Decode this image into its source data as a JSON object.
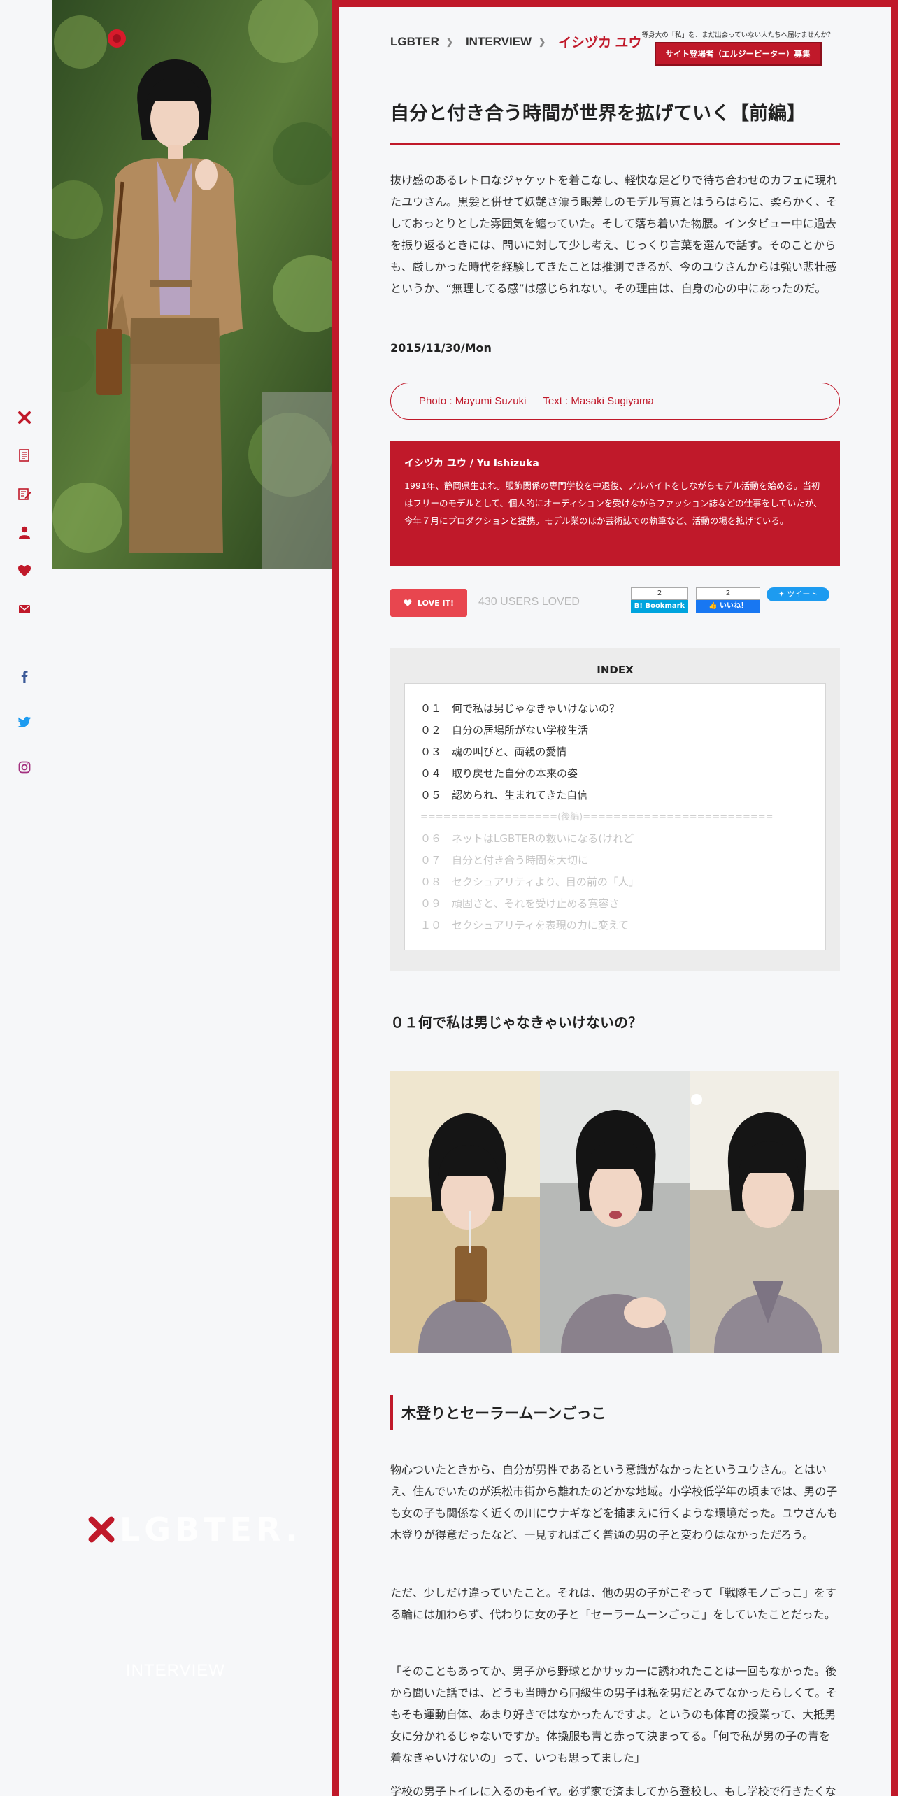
{
  "rail": {
    "icons": [
      "lgbter-x-icon",
      "article-icon",
      "edit-icon",
      "person-icon",
      "heart-icon",
      "mail-icon",
      "facebook-icon",
      "twitter-icon",
      "instagram-icon"
    ]
  },
  "hero": {
    "logo_text": "LGBTER.",
    "category": "INTERVIEW"
  },
  "breadcrumb": {
    "home": "LGBTER",
    "category": "INTERVIEW",
    "current": "イシヅカ ユウ"
  },
  "recruit": {
    "note": "等身大の「私」を、まだ出会っていない人たちへ届けませんか？",
    "button": "サイト登場者（エルジービーター）募集"
  },
  "article": {
    "title": "自分と付き合う時間が世界を拡げていく【前編】",
    "lead": "抜け感のあるレトロなジャケットを着こなし、軽快な足どりで待ち合わせのカフェに現れたユウさん。黒髪と併せて妖艶さ漂う眼差しのモデル写真とはうらはらに、柔らかく、そしておっとりとした雰囲気を纏っていた。そして落ち着いた物腰。インタビュー中に過去を振り返るときには、問いに対して少し考え、じっくり言葉を選んで話す。そのことからも、厳しかった時代を経験してきたことは推測できるが、今のユウさんからは強い悲壮感というか、“無理してる感”は感じられない。その理由は、自身の心の中にあったのだ。",
    "date": "2015/11/30/Mon",
    "photo_credit": "Photo : Mayumi Suzuki",
    "text_credit": "Text : Masaki Sugiyama"
  },
  "profile": {
    "name": "イシヅカ ユウ / Yu Ishizuka",
    "text": "1991年、静岡県生まれ。服飾関係の専門学校を中退後、アルバイトをしながらモデル活動を始める。当初はフリーのモデルとして、個人的にオーディションを受けながらファッション誌などの仕事をしていたが、今年７月にプロダクションと提携。モデル業のほか芸術誌での執筆など、活動の場を拡げている。"
  },
  "actions": {
    "love_label": "LOVE IT!",
    "loved_count": "430 USERS LOVED",
    "hatena_count": "2",
    "hatena_label": "B! Bookmark",
    "fb_count": "2",
    "fb_label": "いいね！",
    "tweet_label": "ツイート",
    "colors": {
      "love": "#e8464f",
      "hatena": "#00a4de",
      "facebook": "#1877f2",
      "twitter": "#1d9bf0"
    }
  },
  "index": {
    "title": "INDEX",
    "items": [
      "０１　何で私は男じゃなきゃいけないの？",
      "０２　自分の居場所がない学校生活",
      "０３　魂の叫びと、両親の愛情",
      "０４　取り戻せた自分の本来の姿",
      "０５　認められ、生まれてきた自信"
    ],
    "separator": "==================(後編)=========================",
    "later_items": [
      "０６　ネットはLGBTERの救いになる(けれど",
      "０７　自分と付き合う時間を大切に",
      "０８　セクシュアリティより、目の前の「人」",
      "０９　頑固さと、それを受け止める寛容さ",
      "１０　セクシュアリティを表現の力に変えて"
    ]
  },
  "section1": {
    "heading": "０１何で私は男じゃなきゃいけないの？",
    "subheading": "木登りとセーラームーンごっこ",
    "paragraphs": [
      "物心ついたときから、自分が男性であるという意識がなかったというユウさん。とはいえ、住んでいたのが浜松市街から離れたのどかな地域。小学校低学年の頃までは、男の子も女の子も関係なく近くの川にウナギなどを捕まえに行くような環境だった。ユウさんも木登りが得意だったなど、一見すればごく普通の男の子と変わりはなかっただろう。",
      "ただ、少しだけ違っていたこと。それは、他の男の子がこぞって「戦隊モノごっこ」をする輪には加わらず、代わりに女の子と「セーラームーンごっこ」をしていたことだった。",
      "「そのこともあってか、男子から野球とかサッカーに誘われたことは一回もなかった。後から聞いた話では、どうも当時から同級生の男子は私を男だとみてなかったらしくて。そもそも運動自体、あまり好きではなかったんですよ。というのも体育の授業って、大抵男女に分かれるじゃないですか。体操服も青と赤って決まってる。「何で私が男の子の青を着なきゃいけないの」って、いつも思ってました」",
      "学校の男子トイレに入るのもイヤ。必ず家で済ましてから登校し、もし学校で行きたくなったら、"
    ]
  }
}
